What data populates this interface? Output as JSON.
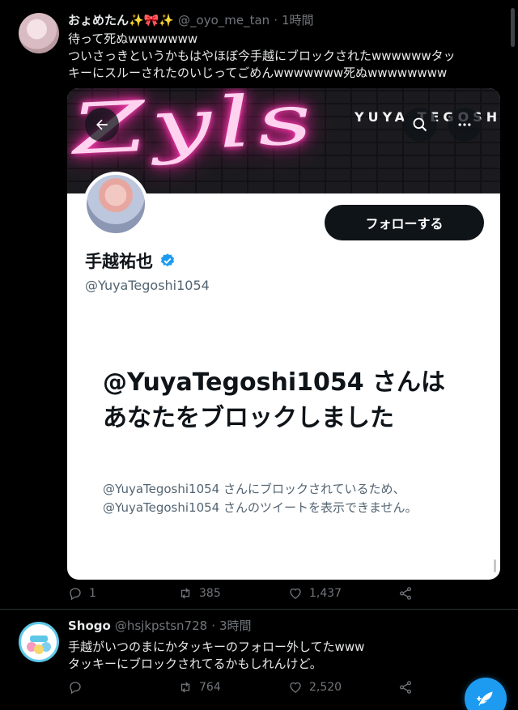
{
  "tweet1": {
    "display_name": "おょめたん✨🎀✨",
    "handle": "@_oyo_me_tan",
    "separator": "·",
    "time": "1時間",
    "text_lines": [
      "待って死ぬwwwwwww",
      "ついさっきというかもはやほぼ今手越にブロックされたwwwwwwタッ",
      "キーにスルーされたのいじってごめんwwwwwww死ぬwwwwwwww"
    ],
    "card": {
      "banner_neon": "Zyls",
      "banner_brand": "YUYA TEGOSHI",
      "follow_label": "フォローする",
      "profile_name": "手越祐也",
      "profile_handle": "@YuyaTegoshi1054",
      "blocked_title": "@YuyaTegoshi1054 さんはあなたをブロックしました",
      "blocked_desc_line1": "@YuyaTegoshi1054 さんにブロックされているため、",
      "blocked_desc_line2": "@YuyaTegoshi1054 さんのツイートを表示できません。"
    },
    "actions": {
      "replies": "1",
      "retweets": "385",
      "likes": "1,437"
    }
  },
  "tweet2": {
    "display_name": "Shogo",
    "handle": "@hsjkpstsn728",
    "separator": "·",
    "time": "3時間",
    "text_lines": [
      "手越がいつのまにかタッキーのフォロー外してたwww",
      "タッキーにブロックされてるかもしれんけど。"
    ],
    "actions": {
      "replies": "",
      "retweets": "764",
      "likes": "2,520"
    }
  },
  "colors": {
    "accent": "#1d9bf0",
    "background": "#000000",
    "card_background": "#ffffff",
    "neon": "#ff2aa8"
  },
  "icons": [
    "back-arrow-icon",
    "search-icon",
    "more-icon",
    "verified-badge-icon",
    "reply-icon",
    "retweet-icon",
    "like-icon",
    "share-icon",
    "compose-icon"
  ]
}
